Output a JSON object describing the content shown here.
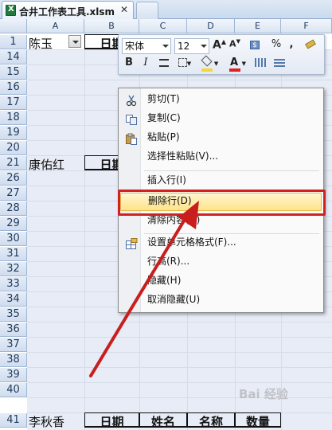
{
  "tab": {
    "title": "合井工作表工具.xlsm",
    "close_glyph": "✕"
  },
  "columns": [
    "A",
    "B",
    "C",
    "D",
    "E",
    "F"
  ],
  "rows": [
    {
      "num": "1"
    },
    {
      "num": "14"
    },
    {
      "num": "15"
    },
    {
      "num": "16"
    },
    {
      "num": "17"
    },
    {
      "num": "18"
    },
    {
      "num": "19"
    },
    {
      "num": "20"
    },
    {
      "num": "21"
    },
    {
      "num": "26"
    },
    {
      "num": "27"
    },
    {
      "num": "28"
    },
    {
      "num": "29"
    },
    {
      "num": "30"
    },
    {
      "num": "31"
    },
    {
      "num": "32"
    },
    {
      "num": "33"
    },
    {
      "num": "34"
    },
    {
      "num": "35"
    },
    {
      "num": "36"
    },
    {
      "num": "37"
    },
    {
      "num": "38"
    },
    {
      "num": "39"
    },
    {
      "num": "40"
    },
    {
      "num": "41"
    }
  ],
  "cells": {
    "r1_a": "陈玉",
    "r1_b": "日期",
    "r21_a": "康佑红",
    "r21_b": "日期",
    "r41_a": "李秋香",
    "r41_b": "日期",
    "r41_c": "姓名",
    "r41_d": "名称",
    "r41_e": "数量"
  },
  "mini_toolbar": {
    "font_name": "宋体",
    "font_size": "12",
    "grow_font": "A",
    "shrink_font": "A",
    "currency": "$",
    "percent": "%",
    "comma": ",",
    "bold": "B",
    "italic": "I",
    "font_color_letter": "A",
    "colors": {
      "fill": "#f5d838",
      "font": "#e02020"
    }
  },
  "context_menu": {
    "items": [
      {
        "label": "剪切(T)",
        "icon": "scissors-icon"
      },
      {
        "label": "复制(C)",
        "icon": "copy-icon"
      },
      {
        "label": "粘贴(P)",
        "icon": "paste-icon"
      },
      {
        "label": "选择性粘贴(V)..."
      },
      {
        "label": "插入行(I)"
      },
      {
        "label": "删除行(D)"
      },
      {
        "label": "清除内容(N)"
      },
      {
        "label": "设置单元格格式(F)...",
        "icon": "format-cells-icon"
      },
      {
        "label": "行高(R)..."
      },
      {
        "label": "隐藏(H)"
      },
      {
        "label": "取消隐藏(U)"
      }
    ],
    "highlighted_item": "删除行(D)"
  },
  "watermark": "Bai 经验"
}
